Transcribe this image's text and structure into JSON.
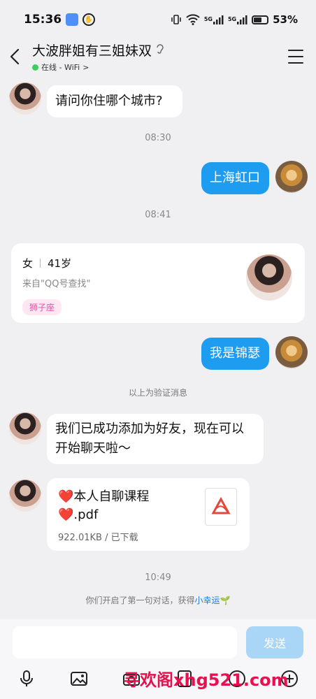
{
  "status_bar": {
    "time": "15:36",
    "network1": "5G",
    "network2": "5G",
    "battery": "53%",
    "battery_level": 0.53
  },
  "header": {
    "title": "大波胖姐有三姐妹双",
    "presence": "在线 - WiFi",
    "presence_arrow": ">"
  },
  "messages": {
    "m1": "请问你住哪个城市?",
    "time1": "08:30",
    "m2": "上海虹口",
    "time2": "08:41",
    "m3": "我是锦瑟",
    "verify_note": "以上为验证消息",
    "m4": "我们已成功添加为好友，现在可以开始聊天啦～",
    "time3": "10:49"
  },
  "profile_card": {
    "gender": "女",
    "age": "41岁",
    "source": "来自\"QQ号查找\"",
    "tag": "狮子座"
  },
  "file": {
    "heart": "❤️",
    "name_part1": "本人自聊课程",
    "name_part2": ".pdf",
    "meta": "922.01KB / 已下载"
  },
  "first_talk": {
    "text": "你们开启了第一句对话，获得",
    "lucky": "小幸运",
    "sprout": "🌱"
  },
  "input": {
    "placeholder": "",
    "send_label": "发送"
  },
  "watermark": "寻欢阁xhg521.com"
}
